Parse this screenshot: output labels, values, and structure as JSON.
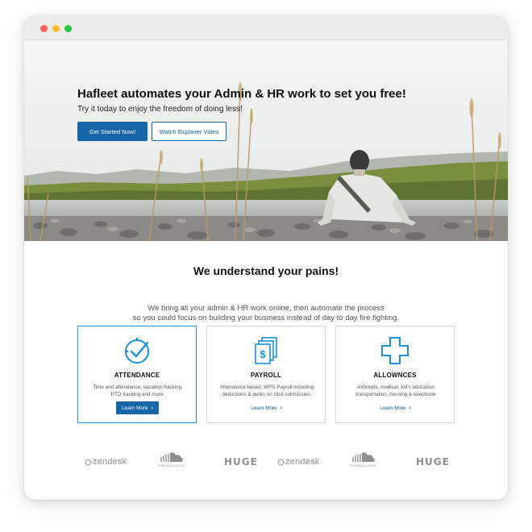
{
  "hero": {
    "title": "Hafleet automates your Admin & HR work to set you free!",
    "subtitle": "Try it today to enjoy the freedom of doing less!",
    "primary_button": "Get Started Now!",
    "secondary_button": "Watch Explaner Video"
  },
  "section": {
    "title": "We understand your pains!",
    "description_lines": [
      "We bring all your admin & HR work online, then automate the process",
      "so you could focus on building your business instead of day to day fire fighting."
    ]
  },
  "cards": [
    {
      "icon": "clock-check-icon",
      "title": "ATTENDANCE",
      "text_lines": [
        "Time and attendance, vacation tracking,",
        "PTO tracking and more."
      ],
      "button": "Learn More",
      "active": true
    },
    {
      "icon": "payroll-documents-icon",
      "title": "PAYROLL",
      "text_lines": [
        "Attendance based, WPS Payroll including",
        "deductions & perks on click submission."
      ],
      "button": "Learn More",
      "active": false
    },
    {
      "icon": "medical-cross-icon",
      "title": "ALLOWNCES",
      "text_lines": [
        "Airtickets, medical, kid's education",
        "transportation, housing & telephone"
      ],
      "button": "Learn More",
      "active": false
    }
  ],
  "logos": [
    {
      "name": "zendesk",
      "text": "zendesk"
    },
    {
      "name": "soundcloud",
      "text": "SOUNDCLOUD"
    },
    {
      "name": "huge",
      "text": "HUGE"
    },
    {
      "name": "zendesk",
      "text": "zendesk"
    },
    {
      "name": "soundcloud",
      "text": "SOUNDCLOUD"
    },
    {
      "name": "huge",
      "text": "HUGE"
    }
  ],
  "colors": {
    "brand_blue": "#1565a8",
    "active_border": "#2a8fd0",
    "icon_blue": "#1a8fd8"
  }
}
